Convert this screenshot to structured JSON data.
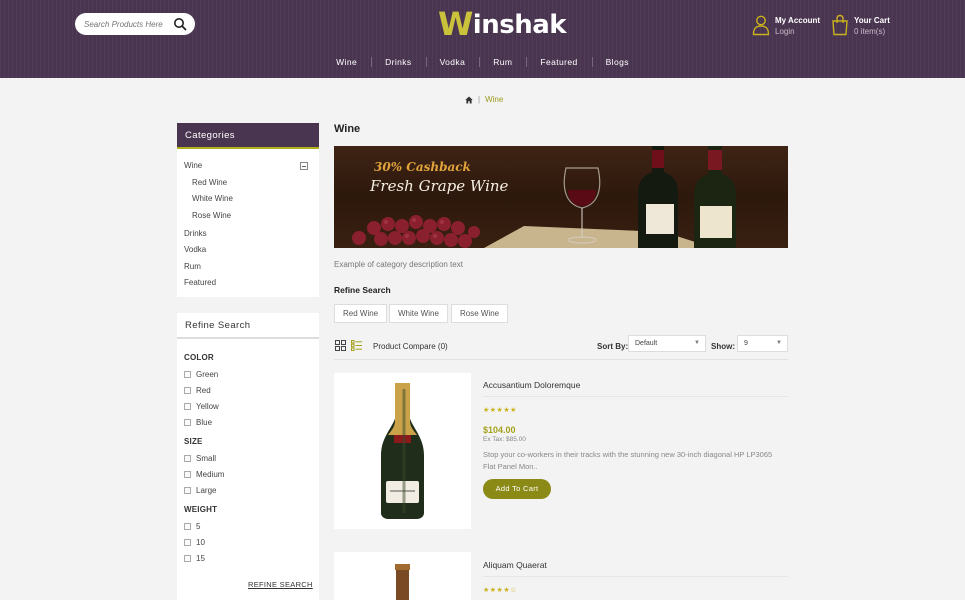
{
  "header": {
    "search_placeholder": "Search Products Here",
    "logo_initial": "W",
    "logo_rest": "inshak",
    "account_title": "My Account",
    "account_sub": "Login",
    "cart_title": "Your Cart",
    "cart_sub": "0 item(s)",
    "nav": [
      "Wine",
      "Drinks",
      "Vodka",
      "Rum",
      "Featured",
      "Blogs"
    ]
  },
  "breadcrumb": {
    "separator": "|",
    "current": "Wine"
  },
  "sidebar": {
    "categories_title": "Categories",
    "categories": [
      {
        "label": "Wine"
      },
      {
        "label": "Red Wine"
      },
      {
        "label": "White Wine"
      },
      {
        "label": "Rose Wine"
      },
      {
        "label": "Drinks"
      },
      {
        "label": "Vodka"
      },
      {
        "label": "Rum"
      },
      {
        "label": "Featured"
      }
    ],
    "refine_title": "Refine Search",
    "groups": [
      {
        "name": "COLOR",
        "options": [
          "Green",
          "Red",
          "Yellow",
          "Blue"
        ]
      },
      {
        "name": "SIZE",
        "options": [
          "Small",
          "Medium",
          "Large"
        ]
      },
      {
        "name": "WEIGHT",
        "options": [
          "5",
          "10",
          "15"
        ]
      }
    ],
    "refine_button": "REFINE SEARCH"
  },
  "main": {
    "title": "Wine",
    "banner_line1": "30% Cashback",
    "banner_line2": "Fresh Grape Wine",
    "description": "Example of category description text",
    "refine_title": "Refine Search",
    "chips": [
      "Red Wine",
      "White Wine",
      "Rose Wine"
    ],
    "compare": "Product Compare (0)",
    "sort_label": "Sort By:",
    "sort_value": "Default",
    "show_label": "Show:",
    "show_value": "9"
  },
  "products": [
    {
      "name": "Accusantium Doloremque",
      "stars": "★★★★★",
      "rating": 5,
      "price": "$104.00",
      "extax": "Ex Tax: $85.00",
      "description": "Stop your co-workers in their tracks with the stunning new 30-inch diagonal HP LP3065 Flat Panel Mon..",
      "button": "Add To Cart"
    },
    {
      "name": "Aliquam Quaerat",
      "stars": "★★★★☆",
      "rating": 4
    }
  ],
  "colors": {
    "header_bg": "#4a3550",
    "accent": "#b3b01f",
    "button": "#8b8a17"
  }
}
